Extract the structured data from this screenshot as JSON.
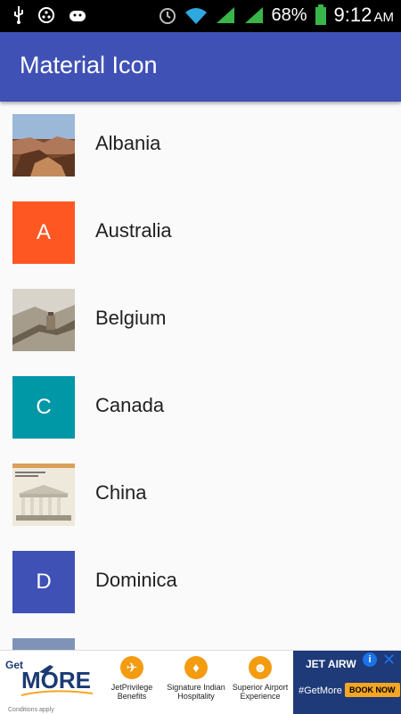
{
  "status_bar": {
    "battery_percent": "68%",
    "time": "9:12",
    "ampm": "AM",
    "icons": [
      "usb-icon",
      "circle-icon",
      "android-icon",
      "alarm-icon",
      "wifi-icon",
      "signal-icon",
      "signal-icon",
      "battery-icon"
    ]
  },
  "app_bar": {
    "title": "Material Icon"
  },
  "list": {
    "items": [
      {
        "label": "Albania",
        "avatar_type": "image",
        "image": "canyon"
      },
      {
        "label": "Australia",
        "avatar_type": "letter",
        "letter": "A",
        "color": "#ff5722"
      },
      {
        "label": "Belgium",
        "avatar_type": "image",
        "image": "great-wall"
      },
      {
        "label": "Canada",
        "avatar_type": "letter",
        "letter": "C",
        "color": "#0097a7"
      },
      {
        "label": "China",
        "avatar_type": "image",
        "image": "temple"
      },
      {
        "label": "Dominica",
        "avatar_type": "letter",
        "letter": "D",
        "color": "#3f51b5"
      },
      {
        "label": "",
        "avatar_type": "image",
        "image": "partial"
      }
    ]
  },
  "ad_banner": {
    "logo_text_top": "Get",
    "logo_text_main": "MORE",
    "conditions": "Conditions apply",
    "items": [
      {
        "label": "JetPrivilege Benefits",
        "icon": "plane-icon"
      },
      {
        "label": "Signature Indian Hospitality",
        "icon": "person-icon"
      },
      {
        "label": "Superior Airport Experience",
        "icon": "people-icon"
      }
    ],
    "brand": "JET AIRW",
    "tag": "#GetMore",
    "button": "BOOK NOW",
    "info": "i",
    "close": "✕"
  }
}
